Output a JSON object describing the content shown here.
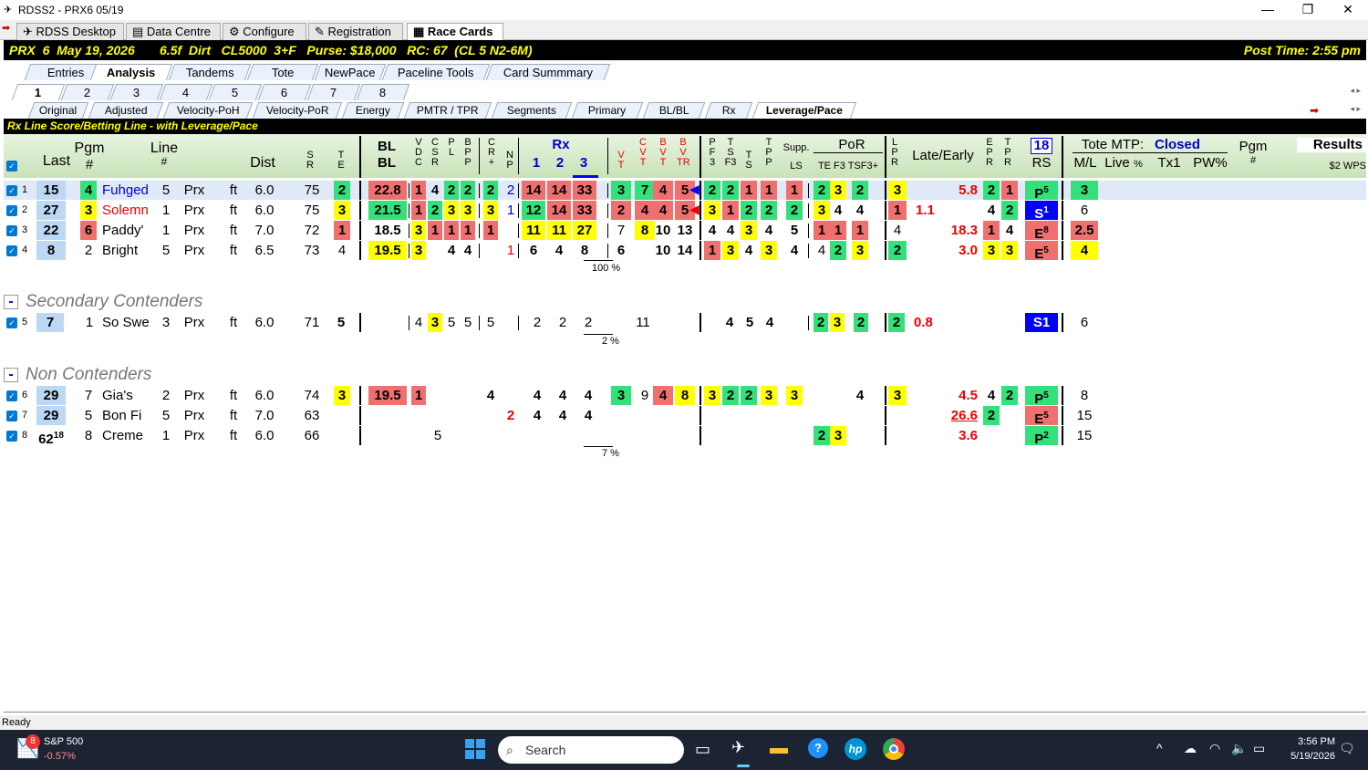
{
  "window": {
    "title": "RDSS2 - PRX6  05/19"
  },
  "tabs": [
    {
      "label": "RDSS Desktop"
    },
    {
      "label": "Data Centre"
    },
    {
      "label": "Configure"
    },
    {
      "label": "Registration"
    },
    {
      "label": "Race Cards"
    }
  ],
  "race": {
    "info": "PRX  6  May 19, 2026       6.5f  Dirt   CL5000  3+F   Purse: $18,000   RC: 67  (CL 5 N2-6M)",
    "post_time": "Post Time: 2:55 pm"
  },
  "sub_tabs": [
    "Entries",
    "Analysis",
    "Tandems",
    "Tote",
    "NewPace",
    "Paceline Tools",
    "Card Summmary"
  ],
  "race_tabs": [
    "1",
    "2",
    "3",
    "4",
    "5",
    "6",
    "7",
    "8"
  ],
  "view_tabs": [
    "Original",
    "Adjusted",
    "Velocity-PoH",
    "Velocity-PoR",
    "Energy",
    "PMTR / TPR",
    "Segments",
    "Primary",
    "BL/BL",
    "Rx",
    "Leverage/Pace"
  ],
  "green_title": "Rx Line Score/Betting Line - with Leverage/Pace",
  "headers": {
    "last": "Last",
    "pgm": "Pgm",
    "pgm_hash": "#",
    "line": "Line",
    "line_hash": "#",
    "dist": "Dist",
    "sr": "S\nR",
    "te": "T\nE",
    "blbl": "BL",
    "blbl2": "BL",
    "rx": "Rx",
    "rx1": "1",
    "rx2": "2",
    "rx3": "3",
    "supp": "Supp.",
    "ls": "LS",
    "por": "PoR",
    "por_sub": "TE F3 TSF3+",
    "late": "Late/Early",
    "rs_num": "18",
    "rs": "RS",
    "tote": "Tote MTP:",
    "tote_status": "Closed",
    "ml": "M/L",
    "live": "Live",
    "pct": "%",
    "tx1": "Tx1",
    "pw": "PW%",
    "pgm2": "Pgm",
    "pgm2_hash": "#",
    "results": "Results",
    "wps": "$2 WPS"
  },
  "contenders": [
    {
      "idx": "1",
      "last": "15",
      "pgm": "4",
      "name": "Fuhged",
      "line": "5",
      "trk": "Prx",
      "surf": "ft",
      "dist": "6.0",
      "sr": "75",
      "te": "2",
      "bl": "22.8",
      "v": [
        "1",
        "4",
        "2",
        "2",
        "2",
        "2"
      ],
      "rx": [
        "14",
        "14",
        "33"
      ],
      "vt": [
        "3",
        "7",
        "4",
        "5"
      ],
      "pf": [
        "2",
        "2",
        "1",
        "1",
        "1"
      ],
      "por": [
        "2",
        "3",
        "2"
      ],
      "lpr": "3",
      "late": "5.8",
      "early": "",
      "epr": [
        "2",
        "1"
      ],
      "rs": "P5",
      "ml": "3"
    },
    {
      "idx": "2",
      "last": "27",
      "pgm": "3",
      "name": "Solemn",
      "line": "1",
      "trk": "Prx",
      "surf": "ft",
      "dist": "6.0",
      "sr": "75",
      "te": "3",
      "bl": "21.5",
      "v": [
        "1",
        "2",
        "3",
        "3",
        "3",
        "1"
      ],
      "rx": [
        "12",
        "14",
        "33"
      ],
      "vt": [
        "2",
        "4",
        "4",
        "5"
      ],
      "pf": [
        "3",
        "1",
        "2",
        "2",
        "2"
      ],
      "por": [
        "3",
        "4",
        "4"
      ],
      "lpr": "1",
      "late": "1.1",
      "early": "",
      "epr": [
        "4",
        "2"
      ],
      "rs": "S1",
      "ml": "6"
    },
    {
      "idx": "3",
      "last": "22",
      "pgm": "6",
      "name": "Paddy'",
      "line": "1",
      "trk": "Prx",
      "surf": "ft",
      "dist": "7.0",
      "sr": "72",
      "te": "1",
      "bl": "18.5",
      "v": [
        "3",
        "1",
        "1",
        "1",
        "1",
        ""
      ],
      "rx": [
        "11",
        "11",
        "27"
      ],
      "vt": [
        "7",
        "8",
        "10",
        "13"
      ],
      "pf": [
        "4",
        "4",
        "3",
        "4",
        "5"
      ],
      "por": [
        "1",
        "1",
        "1"
      ],
      "lpr": "4",
      "late": "18.3",
      "early": "",
      "epr": [
        "1",
        "4"
      ],
      "rs": "E8",
      "ml": "2.5"
    },
    {
      "idx": "4",
      "last": "8",
      "pgm": "2",
      "name": "Bright",
      "line": "5",
      "trk": "Prx",
      "surf": "ft",
      "dist": "6.5",
      "sr": "73",
      "te": "4",
      "bl": "19.5",
      "v": [
        "3",
        "",
        "4",
        "4",
        "",
        "1"
      ],
      "rx": [
        "6",
        "4",
        "8"
      ],
      "vt": [
        "6",
        "",
        "10",
        "14"
      ],
      "pf": [
        "1",
        "3",
        "4",
        "3",
        "4"
      ],
      "por": [
        "4",
        "2",
        "3"
      ],
      "lpr": "2",
      "late": "3.0",
      "early": "",
      "epr": [
        "3",
        "3"
      ],
      "rs": "E5",
      "ml": "4"
    }
  ],
  "pct1": "100 %",
  "secondary_title": "Secondary Contenders",
  "secondary": [
    {
      "idx": "5",
      "last": "7",
      "pgm": "1",
      "name": "So Swe",
      "line": "3",
      "trk": "Prx",
      "surf": "ft",
      "dist": "6.0",
      "sr": "71",
      "te": "5",
      "v": [
        "4",
        "3",
        "5",
        "5",
        "5"
      ],
      "rx": [
        "2",
        "2",
        "2"
      ],
      "vt": "11",
      "pf": [
        "4",
        "5",
        "4"
      ],
      "por": [
        "2",
        "3",
        "2"
      ],
      "lpr": "2",
      "late": "0.8",
      "rs": "S1",
      "ml": "6"
    }
  ],
  "pct2": "2 %",
  "non_title": "Non Contenders",
  "non": [
    {
      "idx": "6",
      "last": "29",
      "pgm": "7",
      "name": "Gia's",
      "line": "2",
      "trk": "Prx",
      "surf": "ft",
      "dist": "6.0",
      "sr": "74",
      "te": "3",
      "bl": "19.5",
      "v1": "1",
      "cr": "4",
      "rx": [
        "4",
        "4",
        "4"
      ],
      "vt": [
        "3",
        "9",
        "4",
        "8"
      ],
      "pf": [
        "3",
        "2",
        "2",
        "3",
        "3"
      ],
      "por3": "4",
      "lpr": "3",
      "late": "4.5",
      "epr": [
        "4",
        "2"
      ],
      "rs": "P5",
      "ml": "8"
    },
    {
      "idx": "7",
      "last": "29",
      "pgm": "5",
      "name": "Bon Fi",
      "line": "5",
      "trk": "Prx",
      "surf": "ft",
      "dist": "7.0",
      "sr": "63",
      "np": "2",
      "rx": [
        "4",
        "4",
        "4"
      ],
      "late": "26.6",
      "epr": [
        "2"
      ],
      "rs": "E5",
      "ml": "15"
    },
    {
      "idx": "8",
      "last": "62",
      "last_sup": "18",
      "pgm": "8",
      "name": "Creme",
      "line": "1",
      "trk": "Prx",
      "surf": "ft",
      "dist": "6.0",
      "sr": "66",
      "cs": "5",
      "por": [
        "2",
        "3"
      ],
      "late": "3.6",
      "rs": "P2",
      "ml": "15"
    }
  ],
  "pct3": "7 %",
  "status": "Ready",
  "taskbar": {
    "stock_name": "S&P 500",
    "stock_change": "-0.57%",
    "badge": "8",
    "search": "Search",
    "time": "3:56 PM",
    "date": "5/19/2026"
  }
}
